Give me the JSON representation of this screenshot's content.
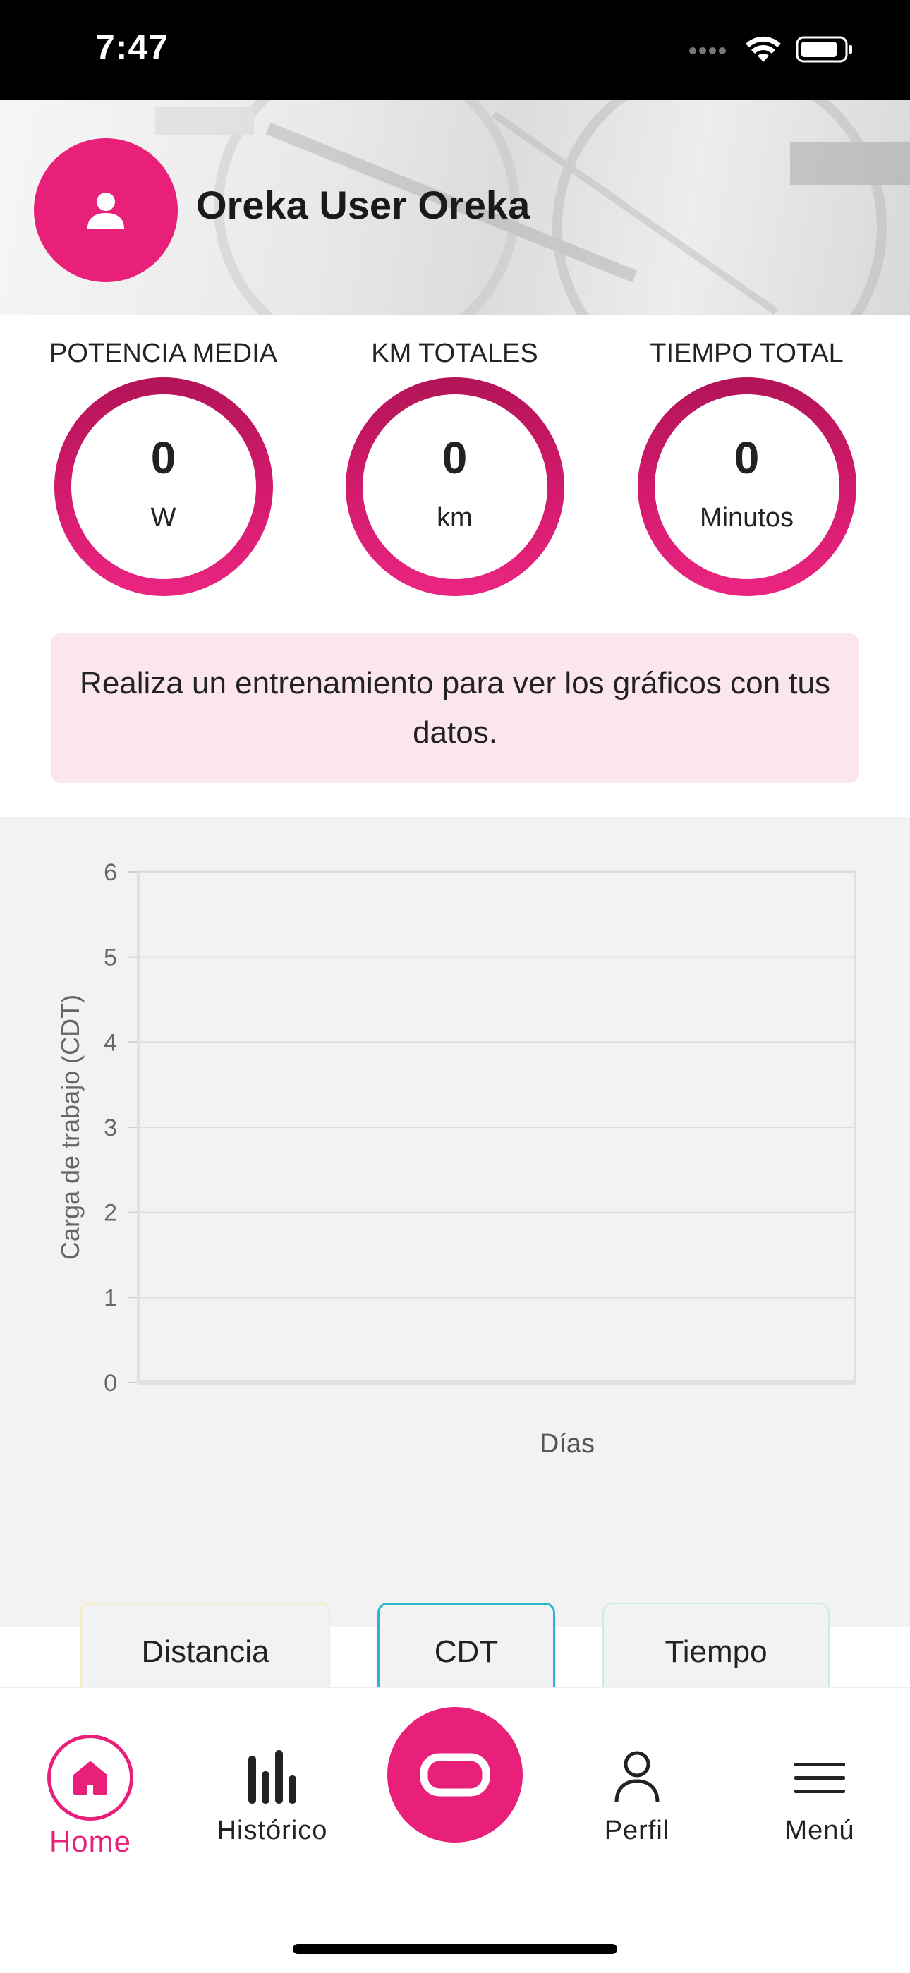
{
  "status_bar": {
    "time": "7:47",
    "icons": [
      "signal-icon",
      "wifi-icon",
      "battery-icon"
    ]
  },
  "header": {
    "user_name": "Oreka User Oreka",
    "avatar_icon": "user-icon"
  },
  "stats": [
    {
      "title": "POTENCIA MEDIA",
      "value": "0",
      "unit": "W"
    },
    {
      "title": "KM TOTALES",
      "value": "0",
      "unit": "km"
    },
    {
      "title": "TIEMPO TOTAL",
      "value": "0",
      "unit": "Minutos"
    }
  ],
  "notice": {
    "text": "Realiza un entrenamiento para ver los gráficos con tus datos."
  },
  "chart_data": {
    "type": "line",
    "title": "",
    "xlabel": "Días",
    "ylabel": "Carga de trabajo (CDT)",
    "ylim": [
      0,
      6
    ],
    "yticks": [
      "0",
      "1",
      "2",
      "3",
      "4",
      "5",
      "6"
    ],
    "x": [],
    "series": [],
    "grid": true
  },
  "metric_buttons": {
    "distancia": "Distancia",
    "cdt": "CDT",
    "tiempo": "Tiempo",
    "selected": "CDT"
  },
  "tabs": [
    {
      "label": "Home",
      "icon": "home-icon",
      "active": true
    },
    {
      "label": "Histórico",
      "icon": "bar-chart-icon",
      "active": false
    },
    {
      "label": "",
      "icon": "oreka-logo-icon",
      "active": false
    },
    {
      "label": "Perfil",
      "icon": "person-icon",
      "active": false
    },
    {
      "label": "Menú",
      "icon": "hamburger-icon",
      "active": false
    }
  ],
  "colors": {
    "accent": "#e8207a",
    "notice_bg": "#fbe5ef",
    "chart_bg": "#f2f2f2",
    "cdt_border": "#2bb6cf"
  }
}
